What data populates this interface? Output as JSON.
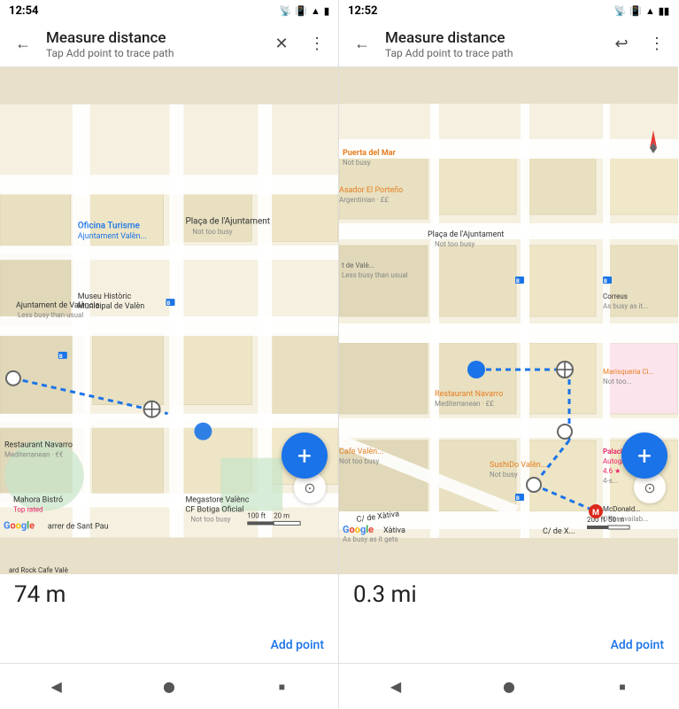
{
  "panel1": {
    "statusTime": "12:54",
    "toolbar": {
      "title": "Measure distance",
      "subtitle": "Tap Add point to trace path",
      "backIcon": "←",
      "closeIcon": "✕",
      "moreIcon": "⋮"
    },
    "distance": "74 m",
    "addPointLabel": "Add point",
    "fabIcon": "+",
    "compassIcon": "◎"
  },
  "panel2": {
    "statusTime": "12:52",
    "toolbar": {
      "title": "Measure distance",
      "subtitle": "Tap Add point to trace path",
      "backIcon": "←",
      "undoIcon": "↩",
      "moreIcon": "⋮"
    },
    "distance": "0.3 mi",
    "addPointLabel": "Add point",
    "fabIcon": "+",
    "compassIcon": "◎"
  },
  "navBar": {
    "backBtn": "◀",
    "homeBtn": "⬤",
    "squareBtn": "■"
  }
}
